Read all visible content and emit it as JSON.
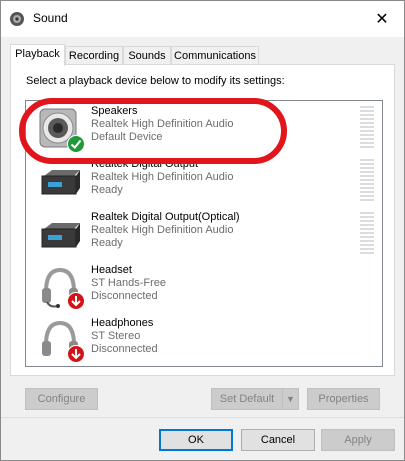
{
  "window": {
    "title": "Sound",
    "close_symbol": "✕"
  },
  "tabs": [
    {
      "label": "Playback",
      "active": true
    },
    {
      "label": "Recording",
      "active": false
    },
    {
      "label": "Sounds",
      "active": false
    },
    {
      "label": "Communications",
      "active": false
    }
  ],
  "playback": {
    "instructions": "Select a playback device below to modify its settings:",
    "devices": [
      {
        "name": "Speakers",
        "description": "Realtek High Definition Audio",
        "status": "Default Device",
        "icon": "speaker-icon",
        "badge": "default-check-icon"
      },
      {
        "name": "Realtek Digital Output",
        "description": "Realtek High Definition Audio",
        "status": "Ready",
        "icon": "digital-output-icon",
        "badge": ""
      },
      {
        "name": "Realtek Digital Output(Optical)",
        "description": "Realtek High Definition Audio",
        "status": "Ready",
        "icon": "digital-output-icon",
        "badge": ""
      },
      {
        "name": "Headset",
        "description": "ST Hands-Free",
        "status": "Disconnected",
        "icon": "headset-icon",
        "badge": "disconnected-arrow-icon"
      },
      {
        "name": "Headphones",
        "description": "ST Stereo",
        "status": "Disconnected",
        "icon": "headphones-icon",
        "badge": "disconnected-arrow-icon"
      }
    ],
    "configure_label": "Configure",
    "set_default_label": "Set Default",
    "properties_label": "Properties"
  },
  "footer": {
    "ok_label": "OK",
    "cancel_label": "Cancel",
    "apply_label": "Apply"
  },
  "colors": {
    "highlight": "#e0161c",
    "accent": "#0078d7",
    "check": "#1e9a3a",
    "disconnected": "#d0141a"
  }
}
